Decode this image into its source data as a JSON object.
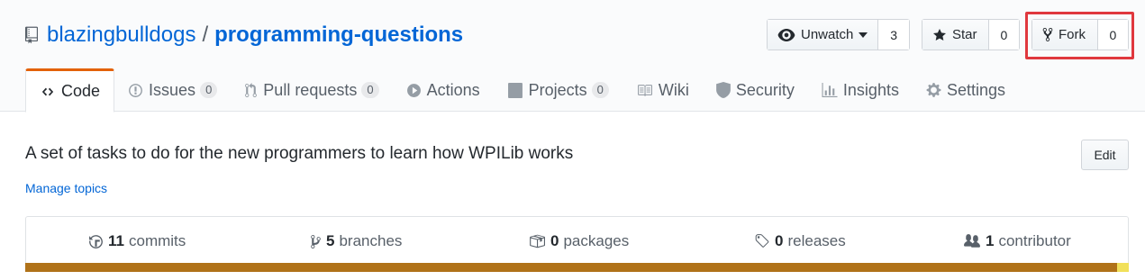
{
  "header": {
    "owner": "blazingbulldogs",
    "separator": "/",
    "repo": "programming-questions",
    "watch": {
      "label": "Unwatch",
      "count": "3"
    },
    "star": {
      "label": "Star",
      "count": "0"
    },
    "fork": {
      "label": "Fork",
      "count": "0"
    },
    "highlight_color": "#e0383e"
  },
  "tabs": [
    {
      "label": "Code",
      "icon": "code-icon",
      "selected": true
    },
    {
      "label": "Issues",
      "icon": "issue-icon",
      "counter": "0"
    },
    {
      "label": "Pull requests",
      "icon": "pull-request-icon",
      "counter": "0"
    },
    {
      "label": "Actions",
      "icon": "play-icon"
    },
    {
      "label": "Projects",
      "icon": "project-icon",
      "counter": "0"
    },
    {
      "label": "Wiki",
      "icon": "book-icon"
    },
    {
      "label": "Security",
      "icon": "shield-icon"
    },
    {
      "label": "Insights",
      "icon": "graph-icon"
    },
    {
      "label": "Settings",
      "icon": "gear-icon"
    }
  ],
  "about": {
    "description": "A set of tasks to do for the new programmers to learn how WPILib works",
    "manage_topics": "Manage topics",
    "edit_label": "Edit"
  },
  "summary": {
    "commits": {
      "count": "11",
      "label": "commits"
    },
    "branches": {
      "count": "5",
      "label": "branches"
    },
    "packages": {
      "count": "0",
      "label": "packages"
    },
    "releases": {
      "count": "0",
      "label": "releases"
    },
    "contributors": {
      "count": "1",
      "label": "contributor"
    }
  },
  "language_bar": [
    {
      "color": "#b07219",
      "fraction": 0.989
    },
    {
      "color": "#f1e05a",
      "fraction": 0.011
    }
  ]
}
